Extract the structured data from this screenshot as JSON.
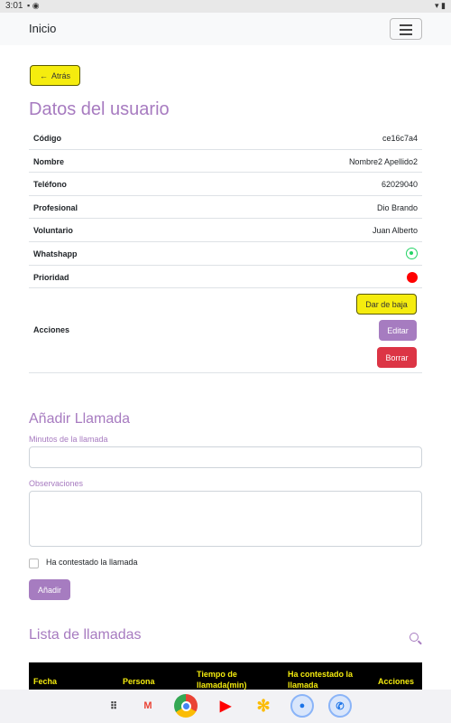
{
  "status_bar": {
    "time": "3:01"
  },
  "navbar": {
    "brand": "Inicio"
  },
  "back_button": {
    "label": "Atrás",
    "arrow": "←"
  },
  "user_section": {
    "title": "Datos del usuario",
    "rows": [
      {
        "label": "Código",
        "value": "ce16c7a4"
      },
      {
        "label": "Nombre",
        "value": "Nombre2 Apellido2"
      },
      {
        "label": "Teléfono",
        "value": "62029040"
      },
      {
        "label": "Profesional",
        "value": "Dio Brando"
      },
      {
        "label": "Voluntario",
        "value": "Juan Alberto"
      },
      {
        "label": "Whatshapp",
        "icon": "whatsapp-icon"
      },
      {
        "label": "Prioridad",
        "icon": "priority-dot",
        "color": "#ff0000"
      }
    ],
    "actions": {
      "label": "Acciones",
      "dar_de_baja": "Dar de baja",
      "editar": "Editar",
      "borrar": "Borrar"
    }
  },
  "add_call": {
    "title": "Añadir Llamada",
    "minutes_label": "Minutos de la llamada",
    "minutes_value": "",
    "observations_label": "Observaciones",
    "observations_value": "",
    "answered_label": "Ha contestado la llamada",
    "answered_checked": false,
    "add_button": "Añadir"
  },
  "call_list": {
    "title": "Lista de llamadas",
    "columns": [
      "Fecha",
      "Persona",
      "Tiempo de llamada(min)",
      "Ha contestado la llamada",
      "Acciones"
    ]
  },
  "colors": {
    "accent": "#a77bc0",
    "yellow": "#f5ec0e",
    "danger": "#dc3545",
    "whatsapp": "#25d366"
  },
  "dock": [
    "apps-grid-icon",
    "gmail-icon",
    "chrome-icon",
    "youtube-icon",
    "photos-icon",
    "messages-icon",
    "phone-icon"
  ]
}
